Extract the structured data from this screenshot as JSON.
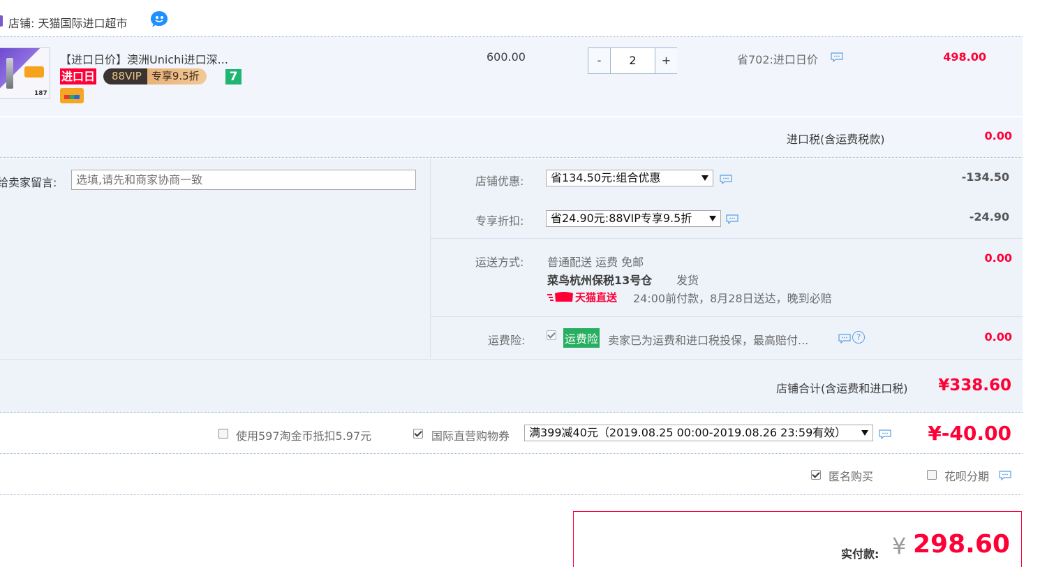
{
  "shop": {
    "label": "店铺: 天猫国际进口超市"
  },
  "item": {
    "title": "【进口日价】澳洲Unichi进口深...",
    "badge_import": "进口日",
    "badge_vip": "88VIP",
    "badge_vip_discount": "专享9.5折",
    "badge_seven": "7",
    "unit_price": "600.00",
    "quantity": "2",
    "qty_minus": "-",
    "qty_plus": "+",
    "promo": "省702:进口日价",
    "subtotal": "498.00",
    "thumb_text": "187"
  },
  "tax": {
    "label": "进口税(含运费税款)",
    "value": "0.00"
  },
  "message": {
    "label": "给卖家留言:",
    "placeholder": "选填,请先和商家协商一致"
  },
  "shop_discount": {
    "label": "店铺优惠:",
    "selected": "省134.50元:组合优惠",
    "value": "-134.50"
  },
  "vip_discount": {
    "label": "专享折扣:",
    "selected": "省24.90元:88VIP专享9.5折",
    "value": "-24.90"
  },
  "shipping": {
    "label": "运送方式:",
    "line1": "普通配送 运费 免邮",
    "warehouse": "菜鸟杭州保税13号仓",
    "ship_word": "发货",
    "brand": "天猫直送",
    "promise": "24:00前付款，8月28日送达，晚到必赔",
    "value": "0.00"
  },
  "insurance": {
    "label": "运费险:",
    "tag": "运费险",
    "text": "卖家已为运费和进口税投保，最高赔付...",
    "help": "?",
    "value": "0.00"
  },
  "shop_total": {
    "label": "店铺合计(含运费和进口税)",
    "value": "¥338.60"
  },
  "coins": {
    "label": "使用597淘金币抵扣5.97元"
  },
  "coupon": {
    "label": "国际直营购物券",
    "selected": "满399减40元（2019.08.25 00:00-2019.08.26 23:59有效）",
    "value": "¥-40.00"
  },
  "options": {
    "anonymous": "匿名购买",
    "huabei": "花呗分期"
  },
  "pay": {
    "label": "实付款:",
    "currency": "¥",
    "value": "298.60"
  },
  "colors": {
    "accent_red": "#ff0036",
    "row_bg": "#eff4fb",
    "border_blue": "#9fb7d0",
    "tag_green": "#27ae60"
  }
}
